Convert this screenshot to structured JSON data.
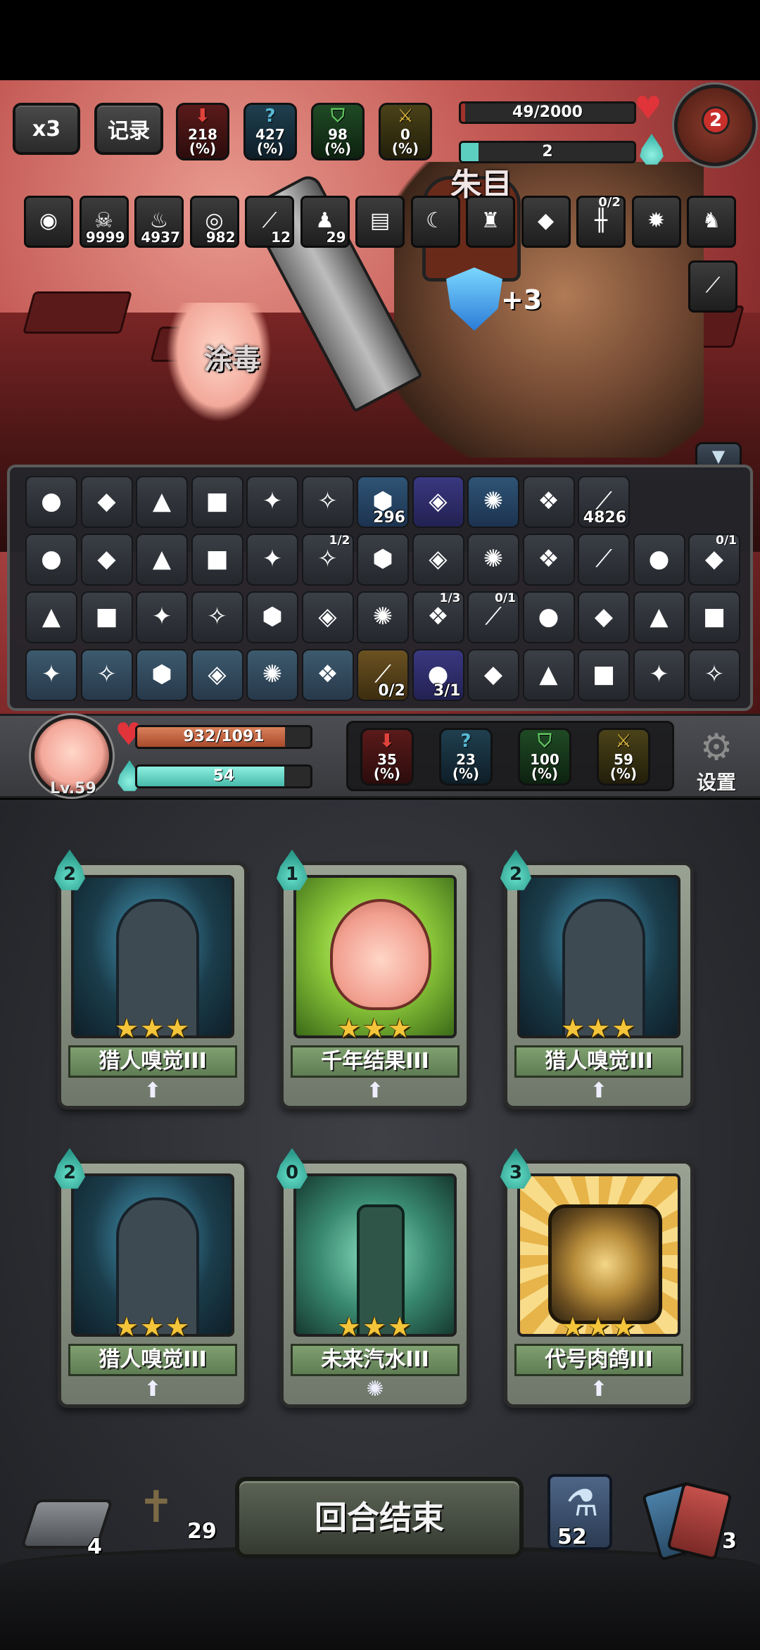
{
  "top_controls": {
    "speed_label": "x3",
    "record_label": "记录"
  },
  "enemy": {
    "name": "朱目",
    "hp_text": "49/2000",
    "hp_fraction": 0.0245,
    "energy_text": "2",
    "energy_fraction": 0.1,
    "shield_text": "+3",
    "level_text": "2",
    "stats": [
      {
        "value": "218",
        "unit": "(%)",
        "color": "#e0433b"
      },
      {
        "value": "427",
        "unit": "(%)",
        "color": "#58b9d6"
      },
      {
        "value": "98",
        "unit": "(%)",
        "color": "#5fc560"
      },
      {
        "value": "0",
        "unit": "(%)",
        "color": "#d9b43c"
      }
    ],
    "buffs": [
      {
        "icon": "boss-portrait-icon",
        "count": ""
      },
      {
        "icon": "skull-icon",
        "count": "9999"
      },
      {
        "icon": "flame-icon",
        "count": "4937"
      },
      {
        "icon": "vortex-icon",
        "count": "982"
      },
      {
        "icon": "claw-scratch-icon",
        "count": "12"
      },
      {
        "icon": "figure-icon",
        "count": "29"
      },
      {
        "icon": "book-icon",
        "count": ""
      },
      {
        "icon": "fang-icon",
        "count": ""
      },
      {
        "icon": "statue-icon",
        "count": ""
      },
      {
        "icon": "green-gem-icon",
        "count": ""
      },
      {
        "icon": "spiked-bar-icon",
        "count": "",
        "top": "0/2"
      },
      {
        "icon": "spiked-ball-icon",
        "count": ""
      },
      {
        "icon": "boar-icon",
        "count": ""
      },
      {
        "icon": "blade-icon",
        "count": ""
      }
    ]
  },
  "player": {
    "status_text": "涂毒",
    "level_text": "Lv.59",
    "hp_text": "932/1091",
    "hp_fraction": 0.854,
    "energy_text": "54",
    "energy_fraction": 0.85,
    "stats": [
      {
        "value": "35",
        "unit": "(%)"
      },
      {
        "value": "23",
        "unit": "(%)"
      },
      {
        "value": "100",
        "unit": "(%)"
      },
      {
        "value": "59",
        "unit": "(%)"
      }
    ],
    "settings_label": "设置"
  },
  "relics": [
    {
      "icon": "bear-head-icon"
    },
    {
      "icon": "cookie-icon"
    },
    {
      "icon": "rice-ball-icon"
    },
    {
      "icon": "egg-icon"
    },
    {
      "icon": "monkey-mask-icon"
    },
    {
      "icon": "staff-icon"
    },
    {
      "icon": "shield-hex-icon",
      "count": "296",
      "style": "rare"
    },
    {
      "icon": "crystal-icon",
      "style": "purple"
    },
    {
      "icon": "rune-hex-icon",
      "style": "rare"
    },
    {
      "icon": "turtle-shell-icon"
    },
    {
      "icon": "claw-mark-icon",
      "count": "4826"
    },
    {
      "icon": "owl-icon"
    },
    {
      "icon": "wok-icon"
    },
    {
      "icon": "thorn-crown-icon"
    },
    {
      "icon": "fire-pot-icon"
    },
    {
      "icon": "log-icon"
    },
    {
      "icon": "boots-icon",
      "top": "1/2"
    },
    {
      "icon": "jar-icon"
    },
    {
      "icon": "dino-egg-icon"
    },
    {
      "icon": "robot-icon"
    },
    {
      "icon": "sack-icon"
    },
    {
      "icon": "tusk-icon"
    },
    {
      "icon": "leaf-gem-icon"
    },
    {
      "icon": "pacifier-icon",
      "top": "0/1"
    },
    {
      "icon": "fossil-icon"
    },
    {
      "icon": "sausage-icon"
    },
    {
      "icon": "shell-cone-icon"
    },
    {
      "icon": "sunglasses-icon"
    },
    {
      "icon": "rifle-icon"
    },
    {
      "icon": "water-orb-icon"
    },
    {
      "icon": "horn-icon"
    },
    {
      "icon": "spellbook-icon",
      "top": "1/3"
    },
    {
      "icon": "galaxy-icon",
      "top": "0/1"
    },
    {
      "icon": "dagger-icon"
    },
    {
      "icon": "spike-bar-icon"
    },
    {
      "icon": "bag-icon"
    },
    {
      "icon": "card-box-icon"
    },
    {
      "icon": "lotus-icon",
      "style": "locked"
    },
    {
      "icon": "bow-icon",
      "style": "locked"
    },
    {
      "icon": "chick-icon",
      "style": "locked"
    },
    {
      "icon": "basket-icon",
      "style": "locked"
    },
    {
      "icon": "potion-flask-icon",
      "style": "locked"
    },
    {
      "icon": "skull-mask-icon",
      "style": "locked"
    },
    {
      "icon": "scroll-icon",
      "count": "0/2",
      "style": "gold"
    },
    {
      "icon": "bullet-icon",
      "count": "3/1",
      "style": "purple"
    },
    {
      "icon": "toad-icon"
    },
    {
      "icon": "pocket-watch-icon"
    },
    {
      "icon": "spear-tip-icon"
    },
    {
      "icon": "goblin-icon"
    },
    {
      "icon": "fish-head-icon"
    }
  ],
  "hand": [
    {
      "cost": "2",
      "name": "猎人嗅觉III",
      "stars": "★★★",
      "art": "hunter",
      "footer_icon": "upgrade-arrow-icon"
    },
    {
      "cost": "1",
      "name": "千年结果III",
      "stars": "★★★",
      "art": "fruit",
      "footer_icon": "upgrade-arrow-icon"
    },
    {
      "cost": "2",
      "name": "猎人嗅觉III",
      "stars": "★★★",
      "art": "hunter",
      "footer_icon": "upgrade-arrow-icon"
    },
    {
      "cost": "2",
      "name": "猎人嗅觉III",
      "stars": "★★★",
      "art": "hunter",
      "footer_icon": "upgrade-arrow-icon"
    },
    {
      "cost": "0",
      "name": "未来汽水III",
      "stars": "★★★",
      "art": "soda",
      "footer_icon": "light-bulb-icon"
    },
    {
      "cost": "3",
      "name": "代号肉鸽III",
      "stars": "★★★",
      "art": "pigeon",
      "footer_icon": "upgrade-arrow-icon"
    }
  ],
  "bottom": {
    "end_turn_label": "回合结束",
    "deck_count": "4",
    "grave_count": "29",
    "potion_count": "52",
    "discard_count": "3"
  }
}
